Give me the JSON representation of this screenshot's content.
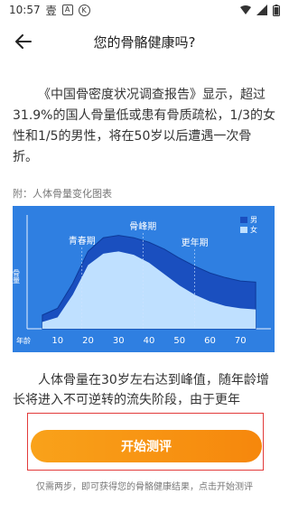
{
  "status": {
    "time": "10:57",
    "char_icon": "壹",
    "a_badge": "A",
    "k_badge": "K"
  },
  "header": {
    "title": "您的骨骼健康吗?"
  },
  "intro_text": "《中国骨密度状况调查报告》显示，超过31.9%的国人骨量低或患有骨质疏松，1/3的女性和1/5的男性，将在50岁以后遭遇一次骨折。",
  "chart_caption": "附：人体骨量变化图表",
  "chart_data": {
    "type": "area",
    "title": "",
    "xlabel": "年龄",
    "ylabel": "骨量",
    "x_ticks": [
      "10",
      "20",
      "30",
      "40",
      "50",
      "60",
      "70"
    ],
    "annotations": [
      "青春期",
      "骨峰期",
      "更年期"
    ],
    "legend_position": "top-right",
    "background": "#2f7fe1",
    "series": [
      {
        "name": "男",
        "color": "#1a4fbf",
        "x": [
          5,
          10,
          15,
          20,
          25,
          30,
          35,
          40,
          45,
          50,
          55,
          60,
          65,
          70,
          75
        ],
        "y": [
          12,
          18,
          40,
          68,
          80,
          82,
          80,
          76,
          70,
          62,
          55,
          49,
          45,
          42,
          41
        ]
      },
      {
        "name": "女",
        "color": "#bfe0ff",
        "x": [
          5,
          10,
          15,
          20,
          25,
          30,
          35,
          40,
          45,
          50,
          55,
          60,
          65,
          70,
          75
        ],
        "y": [
          6,
          10,
          30,
          56,
          66,
          68,
          65,
          58,
          48,
          38,
          30,
          24,
          20,
          18,
          17
        ]
      }
    ]
  },
  "body_text": "人体骨量在30岁左右达到峰值，随年龄增长将进入不可逆转的流失阶段，由于更年",
  "cta_label": "开始测评",
  "cta_note": "仅需两步，即可获得您的骨骼健康结果，点击开始测评"
}
